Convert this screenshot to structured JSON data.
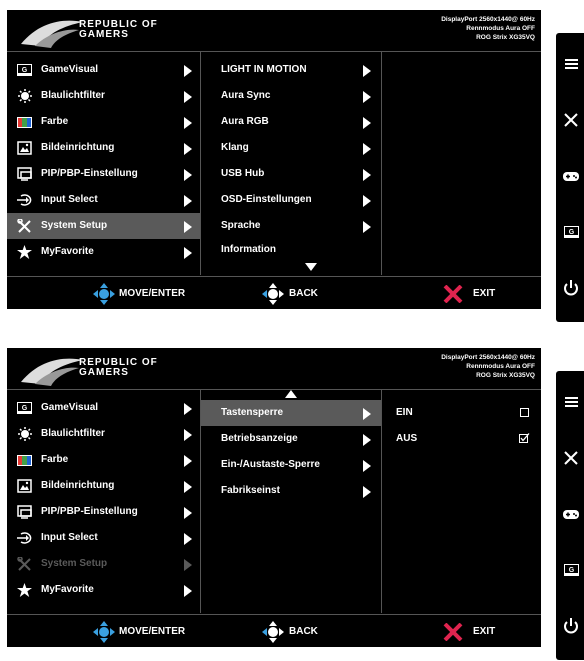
{
  "brand": {
    "line1": "REPUBLIC OF",
    "line2": "GAMERS"
  },
  "status": {
    "line1": "DisplayPort 2560x1440@ 60Hz",
    "line2": "Rennmodus Aura OFF",
    "line3": "ROG Strix XG35VQ"
  },
  "main_menu": [
    {
      "label": "GameVisual",
      "icon": "gamevisual-icon"
    },
    {
      "label": "Blaulichtfilter",
      "icon": "bluelight-icon"
    },
    {
      "label": "Farbe",
      "icon": "color-icon"
    },
    {
      "label": "Bildeinrichtung",
      "icon": "image-icon"
    },
    {
      "label": "PIP/PBP-Einstellung",
      "icon": "pip-icon"
    },
    {
      "label": "Input Select",
      "icon": "input-icon"
    },
    {
      "label": "System Setup",
      "icon": "wrench-icon"
    },
    {
      "label": "MyFavorite",
      "icon": "star-icon"
    }
  ],
  "screen1": {
    "selected_main": "System Setup",
    "submenu": [
      "LIGHT IN MOTION",
      "Aura Sync",
      "Aura RGB",
      "Klang",
      "USB Hub",
      "OSD-Einstellungen",
      "Sprache",
      "Information"
    ]
  },
  "screen2": {
    "selected_main_dimmed": "System Setup",
    "submenu": [
      "Tastensperre",
      "Betriebsanzeige",
      "Ein-/Austaste-Sperre",
      "Fabrikseinst"
    ],
    "options": [
      {
        "label": "EIN",
        "checked": false
      },
      {
        "label": "AUS",
        "checked": true
      }
    ]
  },
  "footer": {
    "move": "MOVE/ENTER",
    "back": "BACK",
    "exit": "EXIT"
  },
  "rail_buttons": [
    "menu-icon",
    "close-icon",
    "gamepad-icon",
    "gamevisual-icon",
    "power-icon"
  ],
  "colors": {
    "background": "#000000",
    "selection": "#5a5a5a",
    "dpad": "#3aa0e0",
    "exit": "#e0244f"
  }
}
